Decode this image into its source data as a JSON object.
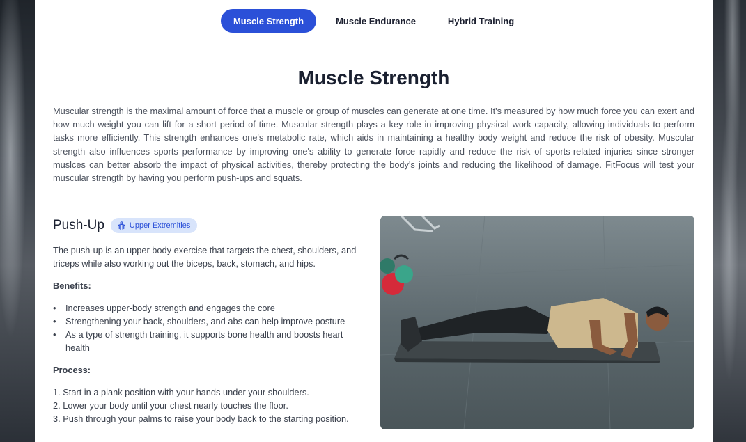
{
  "tabs": [
    {
      "label": "Muscle Strength",
      "active": true
    },
    {
      "label": "Muscle Endurance",
      "active": false
    },
    {
      "label": "Hybrid Training",
      "active": false
    }
  ],
  "section": {
    "title": "Muscle Strength",
    "intro": "Muscular strength is the maximal amount of force that a muscle or group of muscles can generate at one time. It's measured by how much force you can exert and how much weight you can lift for a short period of time. Muscular strength plays a key role in improving physical work capacity, allowing individuals to perform tasks more efficiently. This strength enhances one's metabolic rate, which aids in maintaining a healthy body weight and reduce the risk of obesity. Muscular strength also influences sports performance by improving one's ability to generate force rapidly and reduce the risk of sports-related injuries since stronger muslces can better absorb the impact of physical activities, thereby protecting the body's joints and reducing the likelihood of damage. FitFocus will test your muscular strength by having you perform push-ups and squats."
  },
  "exercise": {
    "name": "Push-Up",
    "badge": "Upper Extremities",
    "badge_icon": "upper-body-icon",
    "description": "The push-up is an upper body exercise that targets the chest, shoulders, and triceps while also working out the biceps, back, stomach, and hips.",
    "benefits_heading": "Benefits:",
    "benefits": [
      "Increases upper-body strength and engages the core",
      "Strengthening your back, shoulders, and abs can help improve posture",
      "As a type of strength training, it supports bone health and boosts heart health"
    ],
    "process_heading": "Process:",
    "steps": [
      "1. Start in a plank position with your hands under your shoulders.",
      "2. Lower your body until your chest nearly touches the floor.",
      "3. Push through your palms to raise your body back to the starting position."
    ]
  },
  "colors": {
    "accent": "#2b50d8",
    "badge_bg": "#d8e4fb"
  }
}
